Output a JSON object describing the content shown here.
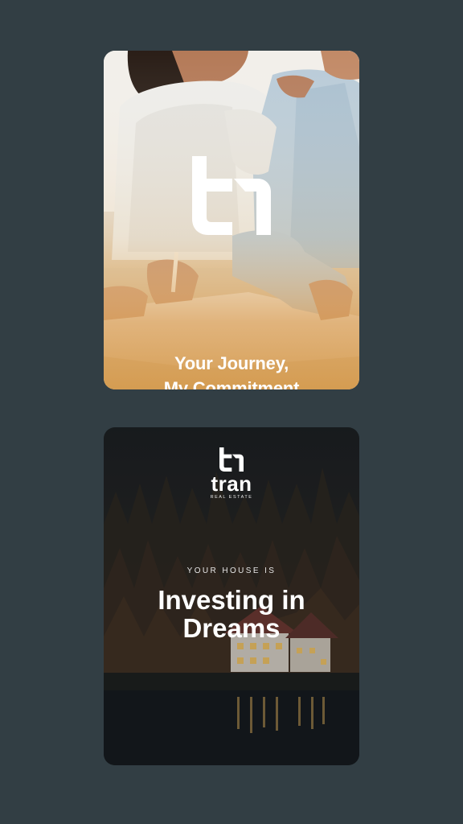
{
  "card1": {
    "logo": "tran-monogram-logo",
    "tagline_line1": "Your Journey,",
    "tagline_line2": "My Commitment"
  },
  "card2": {
    "logo": "tran-monogram-logo",
    "wordmark": "tran",
    "wordmark_sub": "REAL ESTATE",
    "eyebrow": "YOUR HOUSE IS",
    "headline_line1": "Investing in",
    "headline_line2": "Dreams"
  },
  "colors": {
    "background": "#323e44",
    "card1_gradient_bottom": "#d7a55c",
    "text": "#ffffff"
  }
}
